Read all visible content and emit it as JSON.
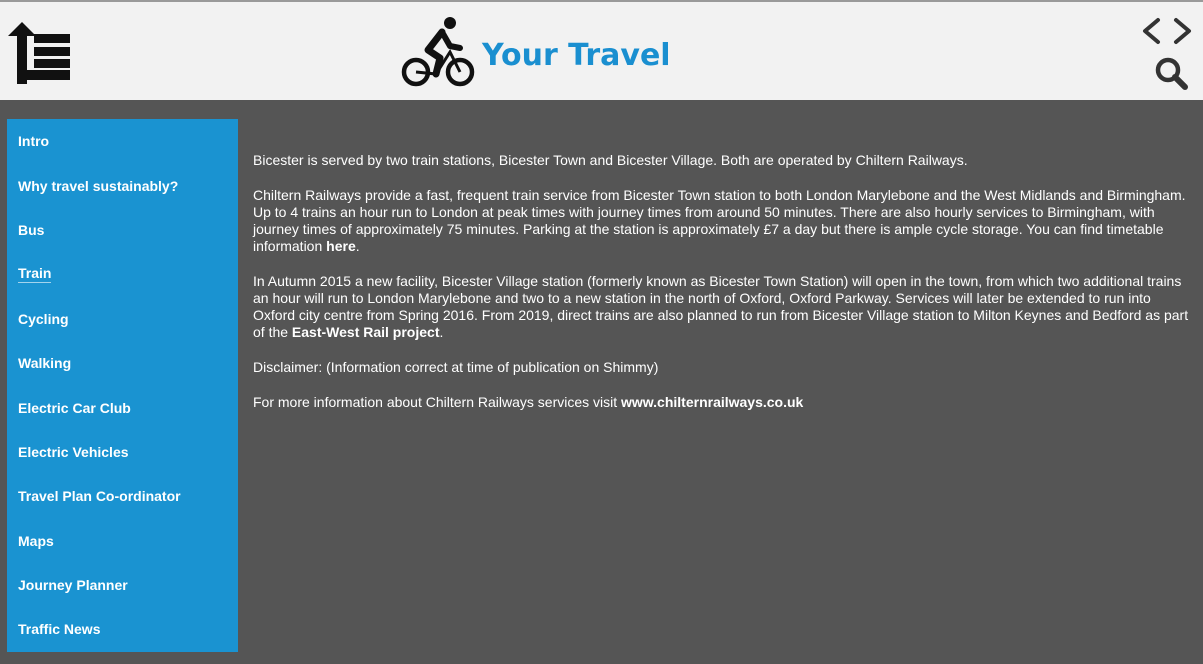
{
  "header": {
    "title": "Your Travel",
    "title_color": "#1a8fd0",
    "icons": {
      "menu": "menu-list-icon",
      "brand": "cyclist-icon",
      "prev": "chevron-left-icon",
      "next": "chevron-right-icon",
      "search": "search-icon"
    }
  },
  "sidebar": {
    "background": "#1a93d1",
    "items": [
      {
        "label": "Intro"
      },
      {
        "label": "Why travel sustainably?"
      },
      {
        "label": "Bus"
      },
      {
        "label": "Train",
        "active": true
      },
      {
        "label": "Cycling"
      },
      {
        "label": "Walking"
      },
      {
        "label": "Electric Car Club"
      },
      {
        "label": "Electric Vehicles"
      },
      {
        "label": "Travel Plan Co-ordinator"
      },
      {
        "label": "Maps"
      },
      {
        "label": "Journey Planner"
      },
      {
        "label": "Traffic News"
      }
    ]
  },
  "content": {
    "p1": "Bicester is served by two train stations, Bicester Town and Bicester Village. Both are operated by Chiltern Railways.",
    "p2_text": "Chiltern Railways provide a fast, frequent train service from Bicester Town station to both London Marylebone and the West Midlands and Birmingham.  Up to 4 trains an hour run to London at peak times with journey times from around 50 minutes. There are also hourly services to Birmingham, with journey times of approximately 75 minutes.  Parking at the station is approximately £7 a day but there is ample cycle storage. You can find timetable information ",
    "p2_link": "here",
    "p2_end": ".",
    "p3_text": "In Autumn 2015 a new facility, Bicester Village station (formerly known as Bicester Town Station) will open in the town, from which two additional trains an hour will run to London Marylebone and two to a new station in the north of Oxford, Oxford Parkway.  Services will later be extended to run into Oxford city centre from Spring 2016.  From 2019, direct trains are also planned to run from Bicester Village station to Milton Keynes and Bedford as part of the ",
    "p3_link": "East-West Rail project",
    "p3_end": ".",
    "p4": "Disclaimer: (Information correct at time of publication on Shimmy)",
    "p5_text": "For more information about Chiltern Railways services visit ",
    "p5_link": "www.chilternrailways.co.uk"
  }
}
